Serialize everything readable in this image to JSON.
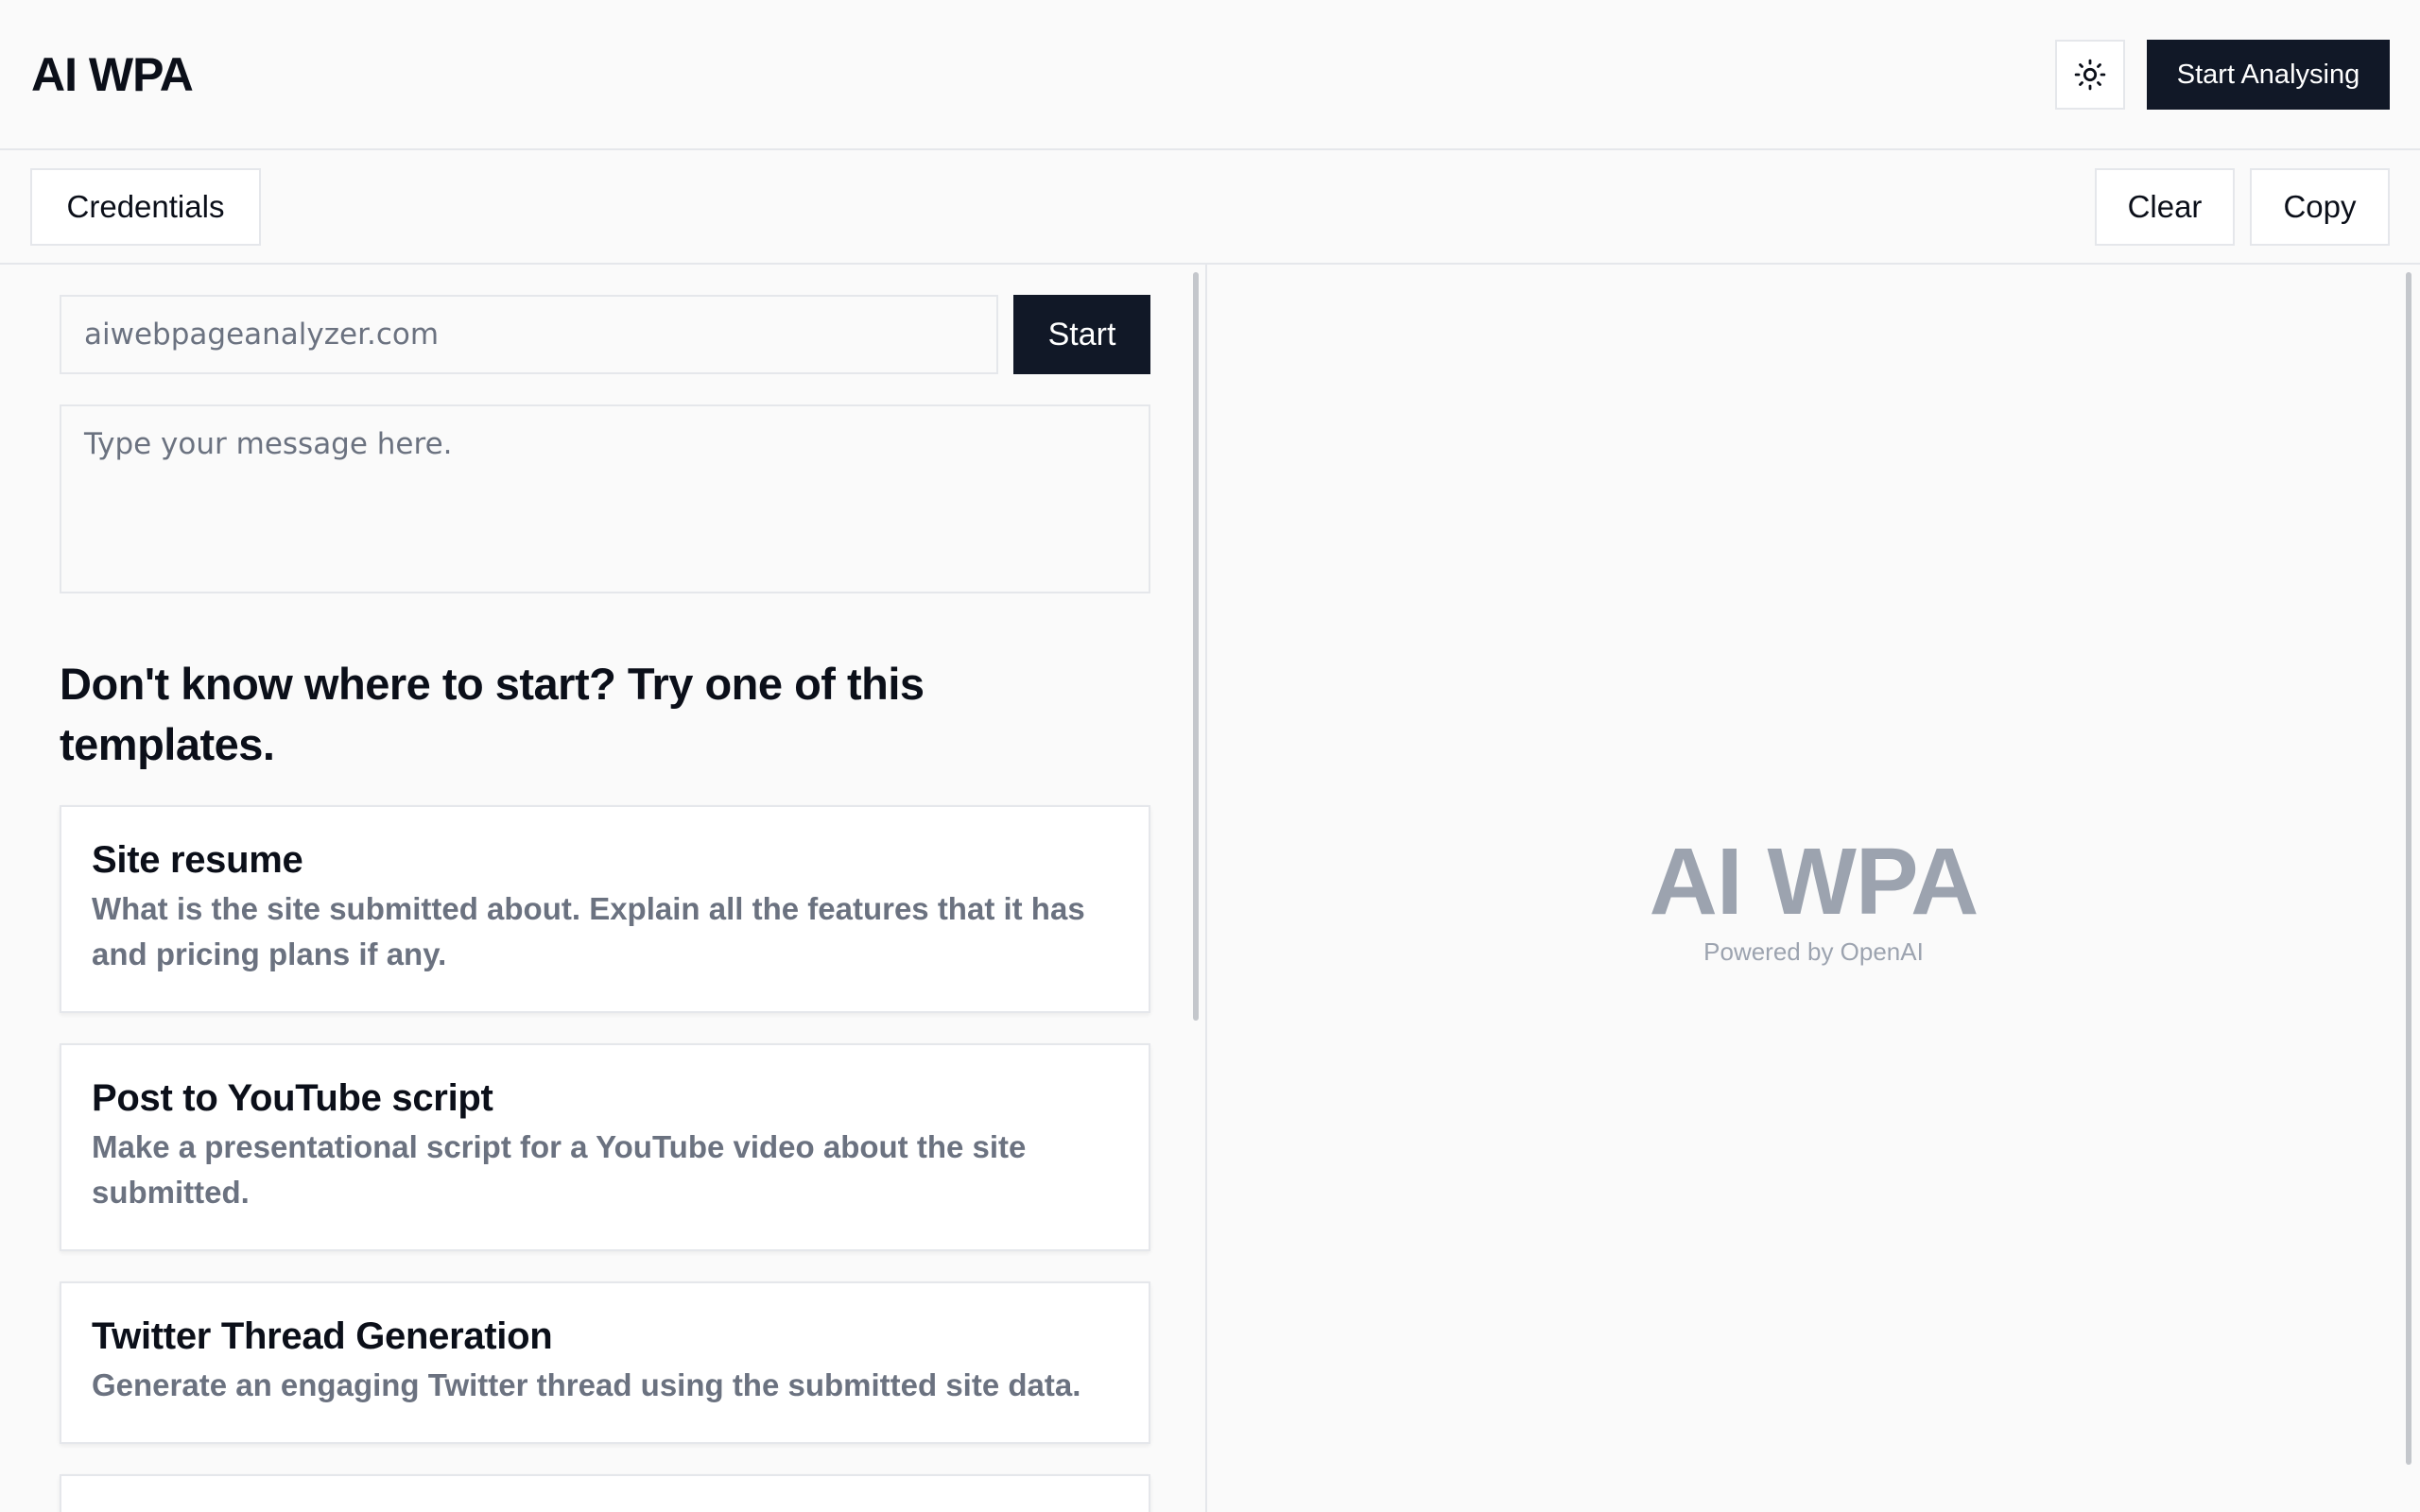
{
  "header": {
    "brand": "AI WPA",
    "theme_icon": "sun-icon",
    "primary_button": "Start Analysing"
  },
  "toolbar": {
    "credentials": "Credentials",
    "clear": "Clear",
    "copy": "Copy"
  },
  "left": {
    "url_placeholder": "aiwebpageanalyzer.com",
    "start_button": "Start",
    "message_placeholder": "Type your message here.",
    "templates_heading": "Don't know where to start? Try one of this templates.",
    "templates": [
      {
        "title": "Site resume",
        "description": "What is the site submitted about. Explain all the features that it has and pricing plans if any."
      },
      {
        "title": "Post to YouTube script",
        "description": "Make a presentational script for a YouTube video about the site submitted."
      },
      {
        "title": "Twitter Thread Generation",
        "description": "Generate an engaging Twitter thread using the submitted site data."
      }
    ]
  },
  "right": {
    "logo": "AI WPA",
    "powered_by": "Powered by OpenAI"
  },
  "colors": {
    "primary": "#111827",
    "muted": "#6b7280",
    "logo_gray": "#9ca3af",
    "border": "#e5e7eb"
  }
}
